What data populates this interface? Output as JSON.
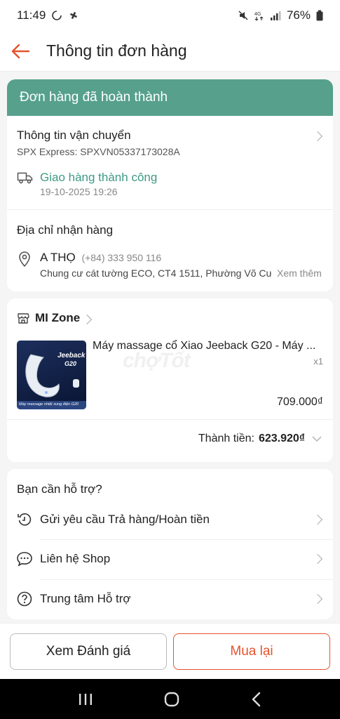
{
  "status_bar": {
    "time": "11:49",
    "battery": "76%"
  },
  "header": {
    "title": "Thông tin đơn hàng"
  },
  "banner": {
    "text": "Đơn hàng đã hoàn thành"
  },
  "shipping": {
    "title": "Thông tin vận chuyển",
    "carrier": "SPX Express: SPXVN05337173028A",
    "status": "Giao hàng thành công",
    "status_time": "19-10-2025 19:26"
  },
  "address": {
    "title": "Địa chỉ nhận hàng",
    "name": "A THỌ",
    "phone": "(+84) 333 950 116",
    "detail": "Chung cư cát tường ECO, CT4 1511, Phường Võ Cư...",
    "more": "Xem thêm"
  },
  "shop": {
    "name": "MI Zone",
    "product": {
      "name": "Máy massage cổ Xiao Jeeback G20 - Máy ...",
      "qty": "x1",
      "price": "709.000₫",
      "image_text_brand": "Jeeback",
      "image_text_model": "G20",
      "image_caption": "Máy massage nhiệt xung điện G20"
    },
    "total_label": "Thành tiền: ",
    "total_value": "623.920₫"
  },
  "watermark": "chợTốt",
  "support": {
    "title": "Bạn cần hỗ trợ?",
    "items": [
      {
        "label": "Gửi yêu cầu Trả hàng/Hoàn tiền",
        "icon": "return-icon"
      },
      {
        "label": "Liên hệ Shop",
        "icon": "chat-icon"
      },
      {
        "label": "Trung tâm Hỗ trợ",
        "icon": "help-icon"
      }
    ]
  },
  "actions": {
    "review": "Xem Đánh giá",
    "rebuy": "Mua lại"
  },
  "colors": {
    "accent": "#e4542e",
    "banner": "#56a08c",
    "status_green": "#3e9a84"
  }
}
